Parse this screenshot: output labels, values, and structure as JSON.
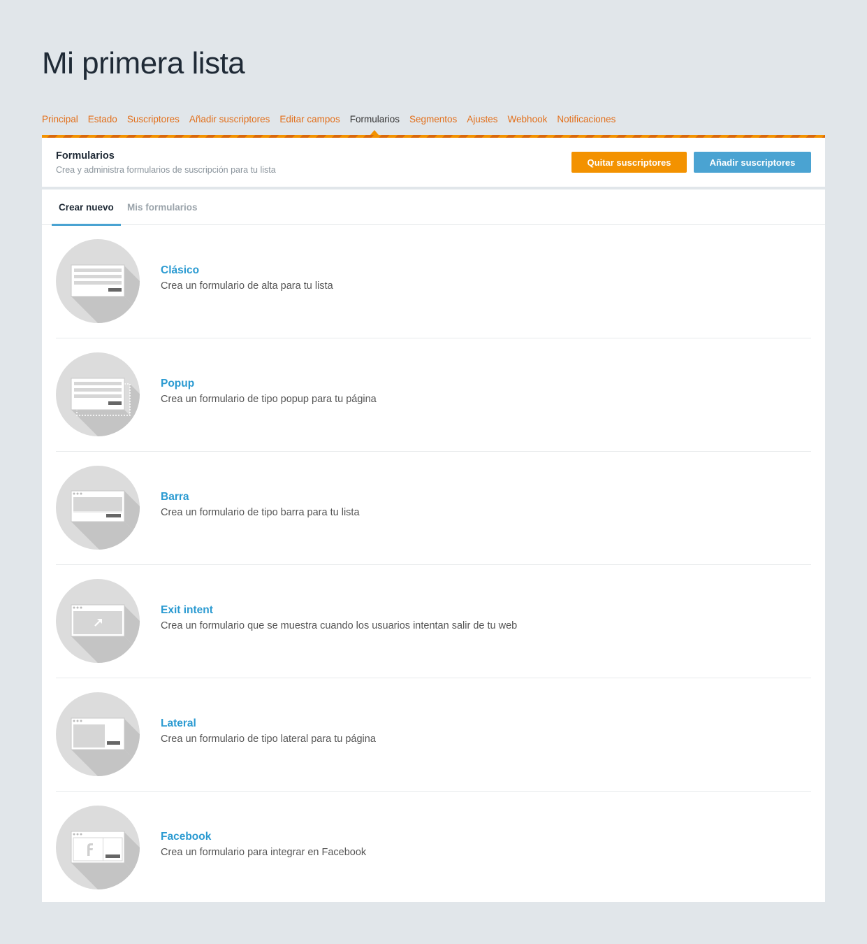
{
  "page": {
    "title": "Mi primera lista"
  },
  "nav": [
    {
      "label": "Principal",
      "active": false
    },
    {
      "label": "Estado",
      "active": false
    },
    {
      "label": "Suscriptores",
      "active": false
    },
    {
      "label": "Añadir suscriptores",
      "active": false
    },
    {
      "label": "Editar campos",
      "active": false
    },
    {
      "label": "Formularios",
      "active": true
    },
    {
      "label": "Segmentos",
      "active": false
    },
    {
      "label": "Ajustes",
      "active": false
    },
    {
      "label": "Webhook",
      "active": false
    },
    {
      "label": "Notificaciones",
      "active": false
    }
  ],
  "header": {
    "title": "Formularios",
    "subtitle": "Crea y administra formularios de suscripción para tu lista",
    "remove_label": "Quitar suscriptores",
    "add_label": "Añadir suscriptores"
  },
  "tabs": {
    "create_label": "Crear nuevo",
    "mine_label": "Mis formularios"
  },
  "forms": [
    {
      "title": "Clásico",
      "description": "Crea un formulario de alta para tu lista",
      "icon": "classic-form-icon"
    },
    {
      "title": "Popup",
      "description": "Crea un formulario de tipo popup para tu página",
      "icon": "popup-form-icon"
    },
    {
      "title": "Barra",
      "description": "Crea un formulario de tipo barra para tu lista",
      "icon": "bar-form-icon"
    },
    {
      "title": "Exit intent",
      "description": "Crea un formulario que se muestra cuando los usuarios intentan salir de tu web",
      "icon": "exit-intent-form-icon"
    },
    {
      "title": "Lateral",
      "description": "Crea un formulario de tipo lateral para tu página",
      "icon": "lateral-form-icon"
    },
    {
      "title": "Facebook",
      "description": "Crea un formulario para integrar en Facebook",
      "icon": "facebook-form-icon"
    }
  ],
  "colors": {
    "accent_orange": "#f39200",
    "accent_blue": "#4aa3d2",
    "link_blue": "#2a9ad1",
    "nav_orange": "#e26f1a"
  }
}
